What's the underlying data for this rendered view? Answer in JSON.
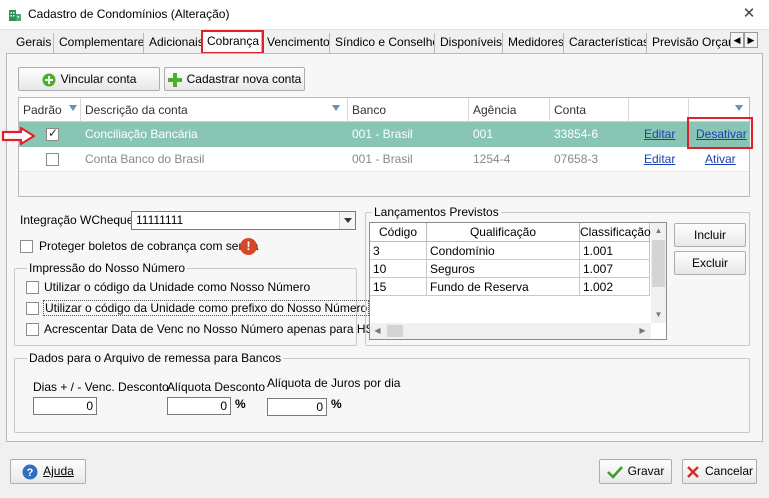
{
  "window": {
    "title": "Cadastro de Condomínios (Alteração)",
    "close_symbol": "✕"
  },
  "tabs": [
    "Gerais",
    "Complementares",
    "Adicionais",
    "Cobrança",
    "Vencimento",
    "Síndico e Conselho",
    "Disponíveis",
    "Medidores",
    "Características",
    "Previsão Orçam"
  ],
  "tab_scroll": {
    "left": "◀",
    "right": "▶"
  },
  "toolbar": {
    "link_account": "Vincular conta",
    "new_account": "Cadastrar nova conta"
  },
  "accounts_grid": {
    "columns": [
      "Padrão",
      "Descrição da conta",
      "Banco",
      "Agência",
      "Conta"
    ],
    "rows": [
      {
        "default": true,
        "description": "Conciliação Bancária",
        "bank": "001 - Brasil",
        "agency": "001",
        "account": "33854-6",
        "edit": "Editar",
        "toggle": "Desativar"
      },
      {
        "default": false,
        "description": "Conta Banco do Brasil",
        "bank": "001 - Brasil",
        "agency": "1254-4",
        "account": "07658-3",
        "edit": "Editar",
        "toggle": "Ativar"
      }
    ]
  },
  "wcheque": {
    "label": "Integração WCheque",
    "value": "11111111"
  },
  "protect_boletos": {
    "label": "Proteger boletos de cobrança com senha",
    "checked": false,
    "warning_symbol": "!"
  },
  "nosso_numero": {
    "title": "Impressão do Nosso Número",
    "options": [
      {
        "label": "Utilizar o código da Unidade como Nosso Número",
        "checked": false
      },
      {
        "label": "Utilizar o código da Unidade como prefixo do Nosso Número",
        "checked": false
      },
      {
        "label": "Acrescentar Data de Venc no Nosso Número apenas para HSBC",
        "checked": false
      }
    ]
  },
  "lancamentos": {
    "title": "Lançamentos Previstos",
    "columns": [
      "Código",
      "Qualificação",
      "Classificação"
    ],
    "rows": [
      {
        "code": "3",
        "qualification": "Condomínio",
        "classification": "1.001"
      },
      {
        "code": "10",
        "qualification": "Seguros",
        "classification": "1.007"
      },
      {
        "code": "15",
        "qualification": "Fundo  de Reserva",
        "classification": "1.002"
      }
    ],
    "include_button": "Incluir",
    "exclude_button": "Excluir"
  },
  "remessa": {
    "title": "Dados para o Arquivo de remessa para Bancos",
    "days_label": "Dias + / - Venc. Desconto",
    "days_value": "0",
    "discount_label": "Alíquota Desconto",
    "discount_value": "0",
    "interest_label": "Alíquota de Juros por dia",
    "interest_value": "0",
    "percent": "%"
  },
  "footer": {
    "help": "Ajuda",
    "save": "Gravar",
    "cancel": "Cancelar"
  },
  "colors": {
    "selected_row": "#88c5b5",
    "highlight": "#e0202a",
    "link": "#1a3fb3",
    "add_icon": "#4caf2a",
    "warning": "#d9472b"
  }
}
